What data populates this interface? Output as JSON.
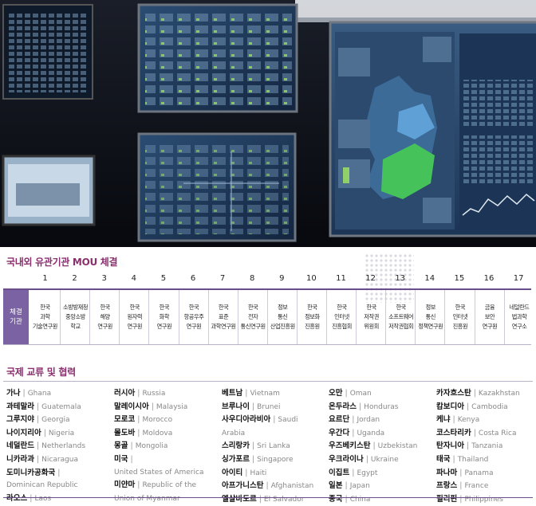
{
  "mou": {
    "title": "국내외 유관기관 MOU 체결",
    "header_label": "체결\n기관",
    "agreements": [
      {
        "no": "1",
        "org": "한국\n과학\n기술연구원"
      },
      {
        "no": "2",
        "org": "소방방재청\n중앙소방\n학교"
      },
      {
        "no": "3",
        "org": "한국\n해양\n연구원"
      },
      {
        "no": "4",
        "org": "한국\n원자력\n연구원"
      },
      {
        "no": "5",
        "org": "한국\n화학\n연구원"
      },
      {
        "no": "6",
        "org": "한국\n항공우주\n연구원"
      },
      {
        "no": "7",
        "org": "한국\n표준\n과학연구원"
      },
      {
        "no": "8",
        "org": "한국\n전자\n통신연구원"
      },
      {
        "no": "9",
        "org": "정보\n통신\n산업진흥원"
      },
      {
        "no": "10",
        "org": "한국\n정보화\n진흥원"
      },
      {
        "no": "11",
        "org": "한국\n인터넷\n진흥협회"
      },
      {
        "no": "12",
        "org": "한국\n저작권\n위원회"
      },
      {
        "no": "13",
        "org": "한국\n소프트웨어\n저작권협회"
      },
      {
        "no": "14",
        "org": "정보\n통신\n정책연구원"
      },
      {
        "no": "15",
        "org": "한국\n인터넷\n진흥원"
      },
      {
        "no": "16",
        "org": "금융\n보안\n연구원"
      },
      {
        "no": "17",
        "org": "네덜란드\n법과학\n연구소"
      }
    ]
  },
  "international": {
    "title": "국제 교류 및 협력",
    "columns": [
      [
        {
          "ko": "가나",
          "en": "Ghana"
        },
        {
          "ko": "과테말라",
          "en": "Guatemala"
        },
        {
          "ko": "그루지야",
          "en": "Georgia"
        },
        {
          "ko": "나이지리아",
          "en": "Nigeria"
        },
        {
          "ko": "네덜란드",
          "en": "Netherlands"
        },
        {
          "ko": "니카라과",
          "en": "Nicaragua"
        },
        {
          "ko": "도미니카공화국",
          "en": ""
        },
        {
          "ko": "",
          "en": "Dominican Republic"
        },
        {
          "ko": "라오스",
          "en": "Laos"
        }
      ],
      [
        {
          "ko": "러시아",
          "en": "Russia"
        },
        {
          "ko": "말레이시아",
          "en": "Malaysia"
        },
        {
          "ko": "모로코",
          "en": "Morocco"
        },
        {
          "ko": "몰도바",
          "en": "Moldova"
        },
        {
          "ko": "몽골",
          "en": "Mongolia"
        },
        {
          "ko": "미국",
          "en": ""
        },
        {
          "ko": "",
          "en": "United States of America"
        },
        {
          "ko": "미얀마",
          "en": "Republic of the"
        },
        {
          "ko": "",
          "en": "Union of Myanmar"
        }
      ],
      [
        {
          "ko": "베트남",
          "en": "Vietnam"
        },
        {
          "ko": "브루나이",
          "en": "Brunei"
        },
        {
          "ko": "사우디아라비아",
          "en": "Saudi"
        },
        {
          "ko": "",
          "en": "Arabia"
        },
        {
          "ko": "스리랑카",
          "en": "Sri Lanka"
        },
        {
          "ko": "싱가포르",
          "en": "Singapore"
        },
        {
          "ko": "아이티",
          "en": "Haiti"
        },
        {
          "ko": "아프가니스탄",
          "en": "Afghanistan"
        },
        {
          "ko": "엘살바도르",
          "en": "El Salvador"
        }
      ],
      [
        {
          "ko": "오만",
          "en": "Oman"
        },
        {
          "ko": "온두라스",
          "en": "Honduras"
        },
        {
          "ko": "요르단",
          "en": "Jordan"
        },
        {
          "ko": "우간다",
          "en": "Uganda"
        },
        {
          "ko": "우즈베키스탄",
          "en": "Uzbekistan"
        },
        {
          "ko": "우크라이나",
          "en": "Ukraine"
        },
        {
          "ko": "이집트",
          "en": "Egypt"
        },
        {
          "ko": "일본",
          "en": "Japan"
        },
        {
          "ko": "중국",
          "en": "China"
        }
      ],
      [
        {
          "ko": "카자흐스탄",
          "en": "Kazakhstan"
        },
        {
          "ko": "캄보디아",
          "en": "Cambodia"
        },
        {
          "ko": "케냐",
          "en": "Kenya"
        },
        {
          "ko": "코스타리카",
          "en": "Costa Rica"
        },
        {
          "ko": "탄자니아",
          "en": "Tanzania"
        },
        {
          "ko": "태국",
          "en": "Thailand"
        },
        {
          "ko": "파나마",
          "en": "Panama"
        },
        {
          "ko": "프랑스",
          "en": "France"
        },
        {
          "ko": "필리핀",
          "en": "Philippines"
        }
      ]
    ]
  },
  "colors": {
    "accent": "#8a2f6e",
    "header_bg": "#7b62a3",
    "rule": "#6a4e8c"
  },
  "photo": {
    "icon": "control-room-monitor-wall-photo"
  }
}
